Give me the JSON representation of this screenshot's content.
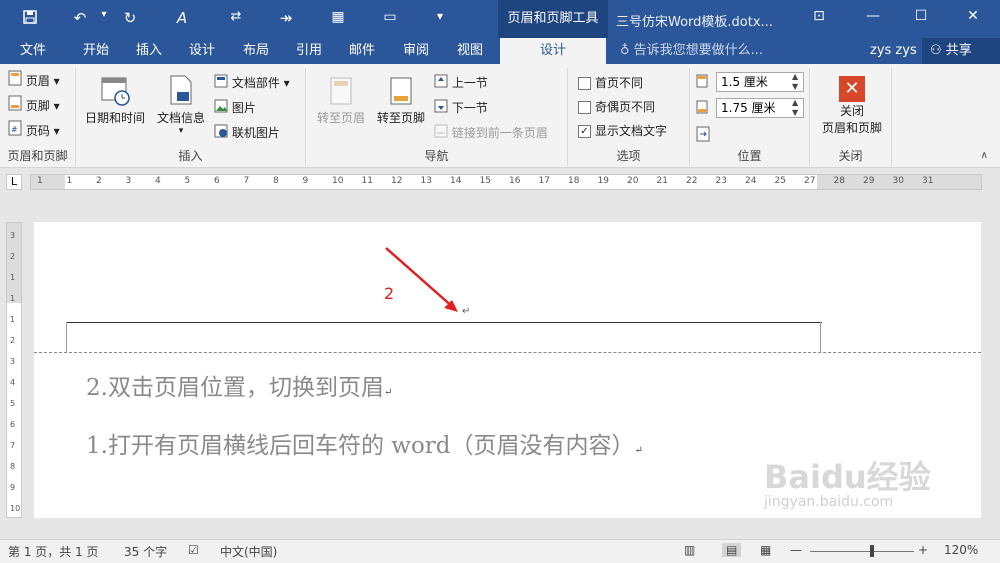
{
  "quick_access": {
    "save_icon": "save-icon",
    "undo_icon": "undo-icon",
    "redo_icon": "redo-icon",
    "format_icon": "format-painter-icon",
    "tools": [
      "touch-icon",
      "forward-icon",
      "grid-icon",
      "screen-icon",
      "dropdown-icon"
    ]
  },
  "context_tool": "页眉和页脚工具",
  "window_title": "三号仿宋Word模板.dotx...",
  "tabs": [
    "文件",
    "开始",
    "插入",
    "设计",
    "布局",
    "引用",
    "邮件",
    "审阅",
    "视图",
    "设计"
  ],
  "tell_me": "告诉我您想要做什么...",
  "user": "zys zys",
  "share": "共享",
  "ribbon": {
    "group1": {
      "items": [
        "页眉",
        "页脚",
        "页码"
      ],
      "label": "页眉和页脚"
    },
    "group2": {
      "datetime": "日期和时间",
      "docinfo": "文档信息",
      "docparts": "文档部件",
      "picture": "图片",
      "online_picture": "联机图片",
      "label": "插入"
    },
    "group3": {
      "goto_header": "转至页眉",
      "goto_footer": "转至页脚",
      "prev": "上一节",
      "next": "下一节",
      "link_prev": "链接到前一条页眉",
      "label": "导航"
    },
    "group4": {
      "first_page": "首页不同",
      "odd_even": "奇偶页不同",
      "show_text": "显示文档文字",
      "show_text_checked": true,
      "label": "选项"
    },
    "group5": {
      "header_pos": "1.5 厘米",
      "footer_pos": "1.75 厘米",
      "label": "位置"
    },
    "group6": {
      "close_line1": "关闭",
      "close_line2": "页眉和页脚",
      "label": "关闭"
    }
  },
  "ruler": {
    "corner": "L",
    "ticks": [
      "1",
      "1",
      "2",
      "3",
      "4",
      "5",
      "6",
      "7",
      "8",
      "9",
      "10",
      "11",
      "12",
      "13",
      "14",
      "15",
      "16",
      "17",
      "18",
      "19",
      "20",
      "21",
      "22",
      "23",
      "24",
      "25",
      "27",
      "28",
      "29",
      "30",
      "31"
    ],
    "vticks": [
      "3",
      "2",
      "1",
      "1",
      "1",
      "2",
      "3",
      "4",
      "5",
      "6",
      "7",
      "8",
      "9",
      "10"
    ]
  },
  "doc": {
    "annotation": "2",
    "line2": "2.双击页眉位置，切换到页眉",
    "line1": "1.打开有页眉横线后回车符的 word（页眉没有内容）",
    "para_mark": "↵",
    "watermark_main": "Baidu经验",
    "watermark_sub": "jingyan.baidu.com"
  },
  "status": {
    "page": "第 1 页，共 1 页",
    "words": "35 个字",
    "lang": "中文(中国)",
    "zoom": "120%",
    "zoom_level": 0.6
  }
}
